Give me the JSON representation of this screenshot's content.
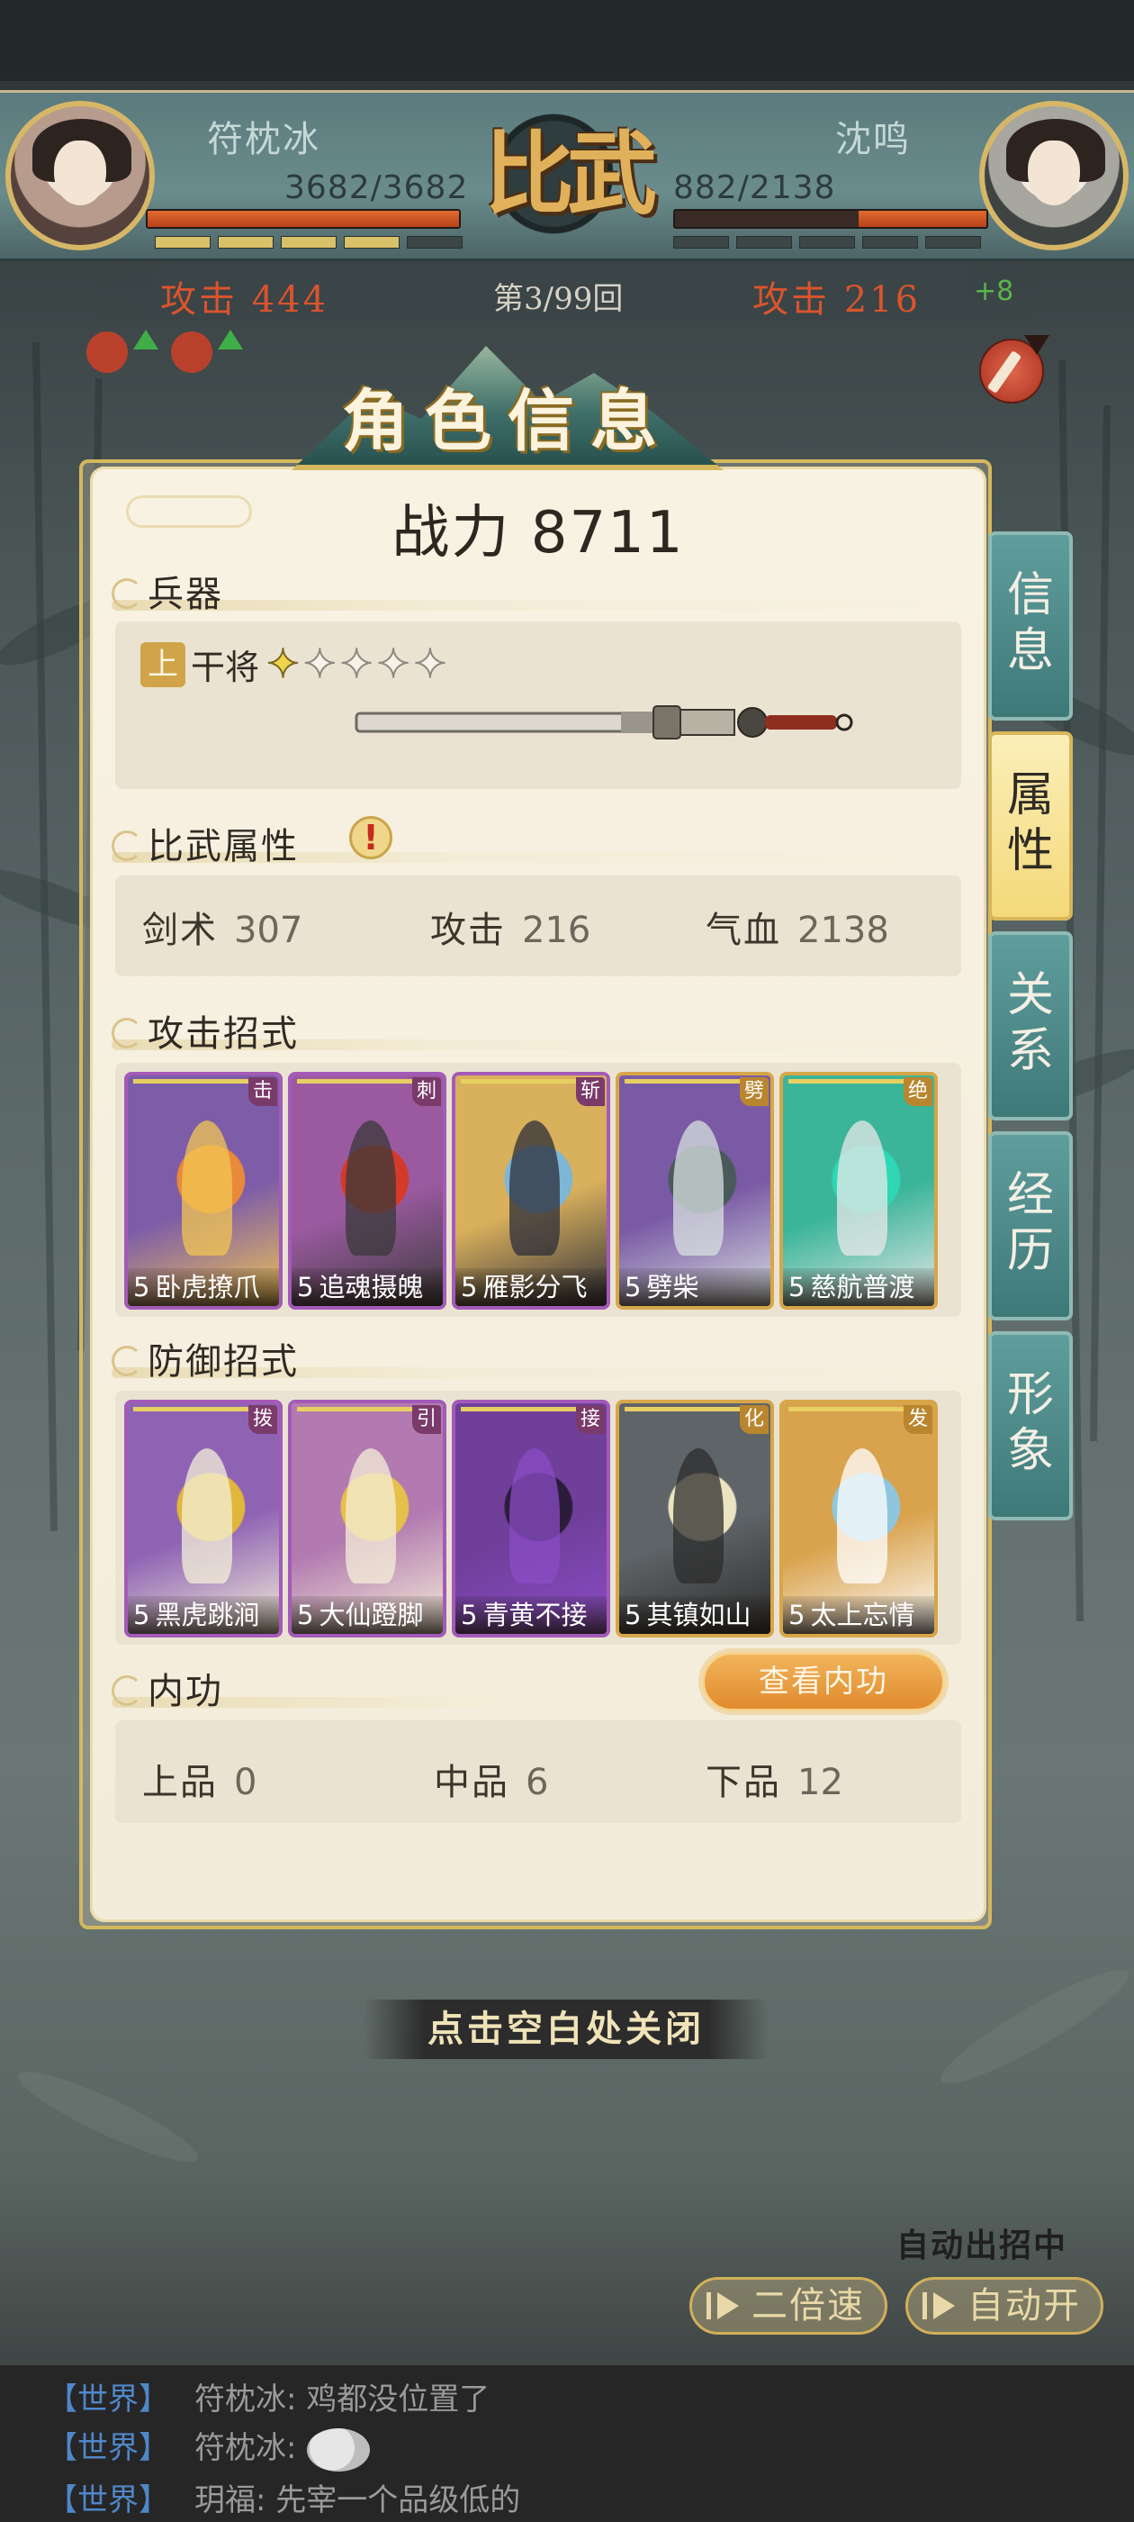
{
  "battle": {
    "title": "比武",
    "player": {
      "name": "符枕冰",
      "hp": "3682/3682",
      "hp_fraction": 1.0,
      "segments_on": 4,
      "attack_label": "攻击",
      "attack": "444"
    },
    "opponent": {
      "name": "沈鸣",
      "hp": "882/2138",
      "hp_fraction": 0.41,
      "segments_on": 0,
      "attack_label": "攻击",
      "attack": "216",
      "bonus": "+8"
    },
    "round": "第3/99回"
  },
  "modal": {
    "title": "角色信息",
    "power_label": "战力",
    "power_value": "8711",
    "weapon": {
      "section": "兵器",
      "grade": "上",
      "name": "干将",
      "stars_total": 5,
      "stars_on": 1
    },
    "attributes": {
      "section": "比武属性",
      "alert": "!",
      "items": [
        {
          "label": "剑术",
          "value": "307"
        },
        {
          "label": "攻击",
          "value": "216"
        },
        {
          "label": "气血",
          "value": "2138"
        }
      ]
    },
    "attack_moves": {
      "section": "攻击招式",
      "cards": [
        {
          "level": "5",
          "name": "卧虎撩爪",
          "tag": "击"
        },
        {
          "level": "5",
          "name": "追魂摄魄",
          "tag": "刺"
        },
        {
          "level": "5",
          "name": "雁影分飞",
          "tag": "斩"
        },
        {
          "level": "5",
          "name": "劈柴",
          "tag": "劈"
        },
        {
          "level": "5",
          "name": "慈航普渡",
          "tag": "绝"
        }
      ]
    },
    "defense_moves": {
      "section": "防御招式",
      "cards": [
        {
          "level": "5",
          "name": "黑虎跳涧",
          "tag": "拨"
        },
        {
          "level": "5",
          "name": "大仙蹬脚",
          "tag": "引"
        },
        {
          "level": "5",
          "name": "青黄不接",
          "tag": "接"
        },
        {
          "level": "5",
          "name": "其镇如山",
          "tag": "化"
        },
        {
          "level": "5",
          "name": "太上忘情",
          "tag": "发"
        }
      ]
    },
    "inner_skill": {
      "section": "内功",
      "view_button": "查看内功",
      "items": [
        {
          "label": "上品",
          "value": "0"
        },
        {
          "label": "中品",
          "value": "6"
        },
        {
          "label": "下品",
          "value": "12"
        }
      ]
    },
    "tabs": [
      "信息",
      "属性",
      "关系",
      "经历",
      "形象"
    ],
    "active_tab": "属性"
  },
  "close_hint": "点击空白处关闭",
  "controls": {
    "auto_status": "自动出招中",
    "speed_button": "二倍速",
    "auto_button": "自动开"
  },
  "chat": [
    {
      "channel": "【世界】",
      "text": "符枕冰: 鸡都没位置了"
    },
    {
      "channel": "【世界】",
      "text": "符枕冰:"
    },
    {
      "channel": "【世界】",
      "text": "玥福: 先宰一个品级低的"
    }
  ]
}
